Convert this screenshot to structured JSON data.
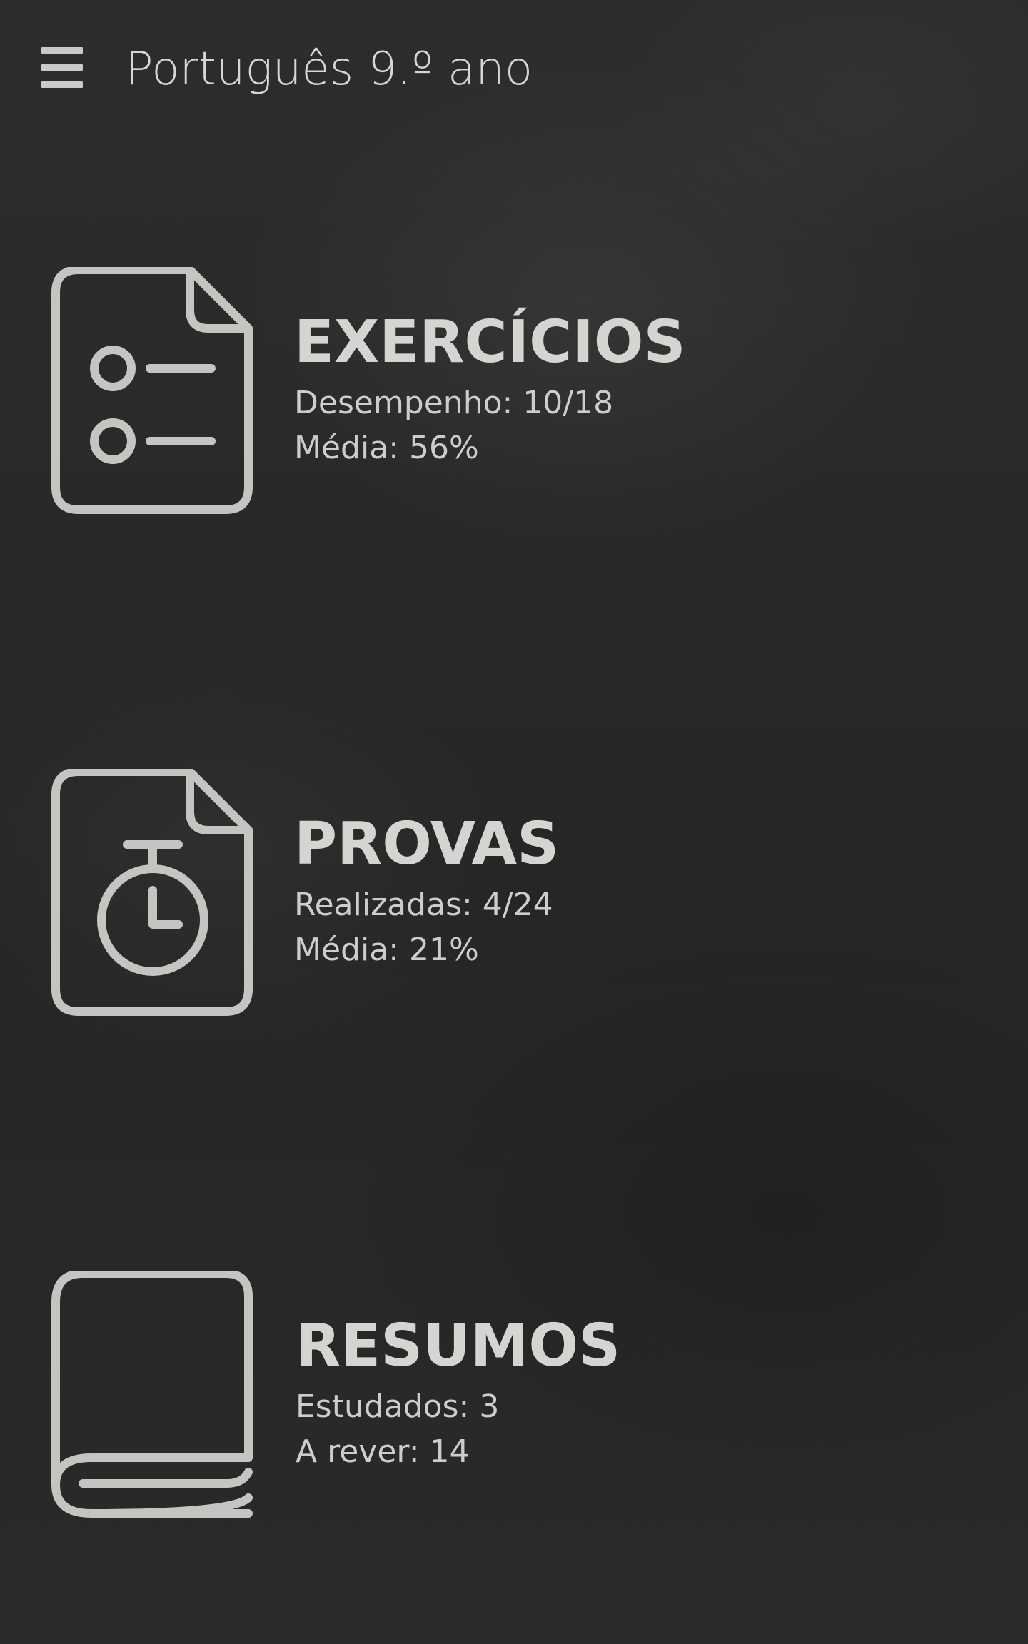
{
  "app_bar": {
    "title": "Português 9.º ano",
    "menu_icon": "menu-icon"
  },
  "colors": {
    "background": "#2a2a2a",
    "foreground": "#cfcfcb",
    "icon_stroke": "#c4c4c0"
  },
  "cards": {
    "exercicios": {
      "icon": "checklist-document-icon",
      "title": "EXERCÍCIOS",
      "line1": "Desempenho: 10/18",
      "line2": "Média: 56%"
    },
    "provas": {
      "icon": "stopwatch-document-icon",
      "title": "PROVAS",
      "line1": "Realizadas: 4/24",
      "line2": "Média: 21%"
    },
    "resumos": {
      "icon": "book-icon",
      "title": "RESUMOS",
      "line1": "Estudados: 3",
      "line2": "A rever: 14"
    }
  }
}
